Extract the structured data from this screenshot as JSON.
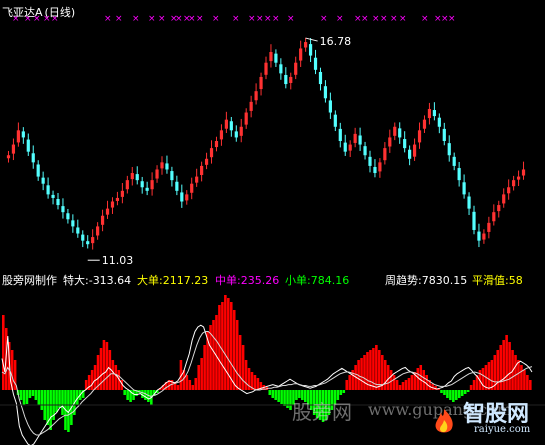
{
  "header": {
    "stock_name": "飞亚达A",
    "period": "(日线)"
  },
  "price_panel": {
    "high_label": "16.78",
    "low_label": "11.03",
    "ylim": [
      10.6,
      17.4
    ],
    "x_markers": [
      [
        12,
        15
      ],
      [
        24,
        27
      ],
      [
        33,
        36
      ],
      [
        43,
        46
      ],
      [
        51,
        54
      ],
      [
        104,
        107
      ],
      [
        115,
        118
      ],
      [
        132,
        135
      ],
      [
        148,
        151
      ],
      [
        158,
        161
      ],
      [
        170,
        173
      ],
      [
        175,
        178
      ],
      [
        183,
        186
      ],
      [
        188,
        191
      ],
      [
        196,
        199
      ],
      [
        212,
        215
      ],
      [
        232,
        235
      ],
      [
        248,
        251
      ],
      [
        256,
        259
      ],
      [
        264,
        267
      ],
      [
        272,
        275
      ],
      [
        287,
        290
      ],
      [
        320,
        323
      ],
      [
        336,
        339
      ],
      [
        354,
        357
      ],
      [
        361,
        364
      ],
      [
        372,
        375
      ],
      [
        380,
        383
      ],
      [
        390,
        393
      ],
      [
        399,
        402
      ],
      [
        421,
        424
      ],
      [
        434,
        437
      ],
      [
        441,
        444
      ],
      [
        448,
        451
      ]
    ]
  },
  "indicator": {
    "title": "股旁网制作",
    "items": [
      {
        "label": "特大:",
        "value": "-313.64",
        "color": "#ffffff"
      },
      {
        "label": "大单:",
        "value": "2117.23",
        "color": "#ffff00"
      },
      {
        "label": "中单:",
        "value": "235.26",
        "color": "#ff00ff"
      },
      {
        "label": "小单:",
        "value": "784.16",
        "color": "#00ff00"
      }
    ],
    "trend_label": "周趋势:",
    "trend_value": "7830.15",
    "smooth_label": "平滑值:",
    "smooth_value": "58",
    "zero_line": 0
  },
  "watermark": {
    "text1": "股旁网",
    "text2": "www.gupang.com",
    "logo_text": "智股网",
    "logo_sub": "raiyue.com"
  },
  "colors": {
    "up": "#ff3232",
    "down": "#54ffff",
    "green_bar": "#00ff00",
    "red_bar": "#ff0000",
    "marker": "#ff00ff",
    "white": "#ffffff",
    "yellow": "#ffff00",
    "magenta": "#ff00ff",
    "lime": "#00ff00"
  },
  "chart_data": [
    {
      "type": "candlestick",
      "title": "飞亚达A (日线)",
      "series": [
        {
          "name": "close",
          "values": [
            13.6,
            13.9,
            14.3,
            14.1,
            13.7,
            13.4,
            13.0,
            12.8,
            12.5,
            12.4,
            12.2,
            12.0,
            11.8,
            11.6,
            11.4,
            11.2,
            11.1,
            11.3,
            11.6,
            11.9,
            12.1,
            12.3,
            12.4,
            12.6,
            12.9,
            13.1,
            12.9,
            12.7,
            12.6,
            12.9,
            13.2,
            13.4,
            13.2,
            12.9,
            12.6,
            12.3,
            12.5,
            12.8,
            13.0,
            13.3,
            13.5,
            13.8,
            14.0,
            14.3,
            14.6,
            14.3,
            14.1,
            14.4,
            14.8,
            15.1,
            15.4,
            15.8,
            16.2,
            16.5,
            16.2,
            15.9,
            15.6,
            15.8,
            16.2,
            16.6,
            16.78,
            16.4,
            16.0,
            15.6,
            15.2,
            14.8,
            14.4,
            14.0,
            13.7,
            13.9,
            14.2,
            13.9,
            13.6,
            13.3,
            13.1,
            13.4,
            13.8,
            14.1,
            14.4,
            14.1,
            13.8,
            13.5,
            13.9,
            14.3,
            14.6,
            14.9,
            14.7,
            14.4,
            14.0,
            13.6,
            13.3,
            12.9,
            12.5,
            12.1,
            11.5,
            11.2,
            11.4,
            11.7,
            12.0,
            12.2,
            12.5,
            12.7,
            12.9,
            13.0,
            13.2
          ]
        }
      ],
      "ylim": [
        10.6,
        17.4
      ],
      "annotations": [
        "16.78",
        "11.03"
      ]
    },
    {
      "type": "bar",
      "title": "股旁网制作",
      "series": [
        {
          "name": "柱",
          "values": [
            75,
            62,
            48,
            40,
            30,
            -5,
            -10,
            -15,
            -14,
            -8,
            -6,
            -10,
            -15,
            -20,
            -30,
            -35,
            -40,
            -30,
            -22,
            -18,
            -25,
            -40,
            -42,
            -35,
            -25,
            -15,
            -10,
            -8,
            10,
            15,
            20,
            25,
            35,
            42,
            50,
            48,
            40,
            30,
            25,
            20,
            10,
            -5,
            -10,
            -12,
            -10,
            -6,
            -3,
            -8,
            -10,
            -12,
            -15,
            -6,
            -3,
            2,
            5,
            8,
            10,
            10,
            8,
            5,
            30,
            20,
            15,
            10,
            5,
            12,
            25,
            32,
            45,
            58,
            65,
            70,
            75,
            85,
            88,
            95,
            92,
            88,
            80,
            70,
            55,
            45,
            30,
            22,
            18,
            15,
            12,
            8,
            5,
            3,
            -5,
            -8,
            -10,
            -12,
            -14,
            -16,
            -18,
            -20,
            -15,
            -10,
            -8,
            -10,
            -12,
            -15,
            -20,
            -25,
            -28,
            -30,
            -32,
            -30,
            -25,
            -20,
            -15,
            -10,
            -5,
            -3,
            10,
            15,
            20,
            25,
            30,
            32,
            35,
            38,
            40,
            42,
            45,
            40,
            35,
            30,
            25,
            20,
            15,
            10,
            5,
            8,
            10,
            12,
            15,
            18,
            22,
            25,
            20,
            15,
            10,
            6,
            4,
            2,
            -3,
            -5,
            -8,
            -10,
            -12,
            -10,
            -8,
            -6,
            -4,
            -2,
            5,
            10,
            15,
            20,
            22,
            25,
            28,
            30,
            35,
            40,
            45,
            50,
            55,
            48,
            40,
            35,
            30,
            25,
            20,
            15,
            10
          ]
        },
        {
          "name": "周趋势",
          "values": [
            35,
            20,
            60,
            10,
            -5,
            -15,
            -40,
            -50,
            -55,
            -60,
            -62,
            -60,
            -55,
            -50,
            -45,
            -40,
            -35,
            -30,
            -28,
            -25,
            -20,
            -18,
            -22,
            -25,
            -20,
            -15,
            -10,
            -6,
            -2,
            0,
            3,
            5,
            10,
            12,
            15,
            18,
            20,
            25,
            22,
            18,
            15,
            10,
            5,
            2,
            0,
            -3,
            -5,
            -5,
            -4,
            -6,
            -8,
            -10,
            -8,
            -4,
            0,
            2,
            5,
            8,
            10,
            9,
            8,
            10,
            15,
            20,
            30,
            40,
            55,
            65,
            70,
            72,
            70,
            60,
            50,
            45,
            40,
            35,
            30,
            25,
            20,
            15,
            10,
            5,
            2,
            0,
            -2,
            -4,
            -3,
            -2,
            0,
            1,
            2,
            3,
            4,
            5,
            6,
            5,
            4,
            6,
            8,
            10,
            12,
            10,
            8,
            6,
            5,
            4,
            3,
            2,
            3,
            4,
            6,
            8,
            10,
            12,
            15,
            18,
            20,
            22,
            24,
            22,
            20,
            18,
            16,
            14,
            12,
            10,
            8,
            6,
            5,
            4,
            3,
            4,
            5,
            8,
            12,
            15,
            18,
            20,
            22,
            24,
            25,
            22,
            20,
            18,
            15,
            12,
            10,
            8,
            5,
            3,
            2,
            1,
            2,
            3,
            5,
            8,
            10,
            15,
            18,
            20,
            22,
            24,
            25,
            22,
            18,
            15,
            10,
            5,
            3,
            2,
            3,
            5,
            8,
            10,
            12,
            15,
            18,
            20,
            25,
            30,
            32,
            30,
            28,
            25,
            20
          ]
        },
        {
          "name": "平滑值",
          "values": [
            20,
            18,
            25,
            20,
            10,
            5,
            -10,
            -20,
            -30,
            -38,
            -44,
            -48,
            -50,
            -50,
            -48,
            -46,
            -44,
            -41,
            -38,
            -35,
            -32,
            -30,
            -28,
            -28,
            -26,
            -24,
            -20,
            -17,
            -13,
            -10,
            -7,
            -4,
            0,
            3,
            6,
            9,
            12,
            15,
            18,
            18,
            17,
            15,
            12,
            9,
            6,
            3,
            0,
            -1,
            -2,
            -3,
            -4,
            -6,
            -7,
            -6,
            -5,
            -3,
            -1,
            2,
            4,
            6,
            7,
            8,
            9,
            11,
            15,
            21,
            30,
            40,
            50,
            58,
            63,
            65,
            65,
            62,
            58,
            54,
            49,
            44,
            39,
            34,
            29,
            24,
            19,
            15,
            11,
            8,
            5,
            3,
            1,
            0,
            0,
            1,
            1,
            2,
            2,
            3,
            3,
            4,
            5,
            5,
            6,
            6,
            7,
            7,
            6,
            5,
            5,
            4,
            4,
            5,
            5,
            6,
            7,
            8,
            10,
            12,
            14,
            16,
            18,
            19,
            20,
            20,
            19,
            18,
            17,
            15,
            14,
            12,
            10,
            9,
            7,
            6,
            6,
            6,
            7,
            8,
            10,
            12,
            14,
            16,
            18,
            19,
            20,
            20,
            19,
            18,
            16,
            14,
            12,
            10,
            8,
            6,
            5,
            4,
            4,
            4,
            5,
            6,
            8,
            10,
            12,
            14,
            16,
            18,
            19,
            20,
            19,
            18,
            16,
            14,
            12,
            10,
            9,
            9,
            9,
            10,
            11,
            12,
            14,
            16,
            18,
            20,
            22,
            24,
            25,
            26
          ]
        }
      ]
    }
  ]
}
